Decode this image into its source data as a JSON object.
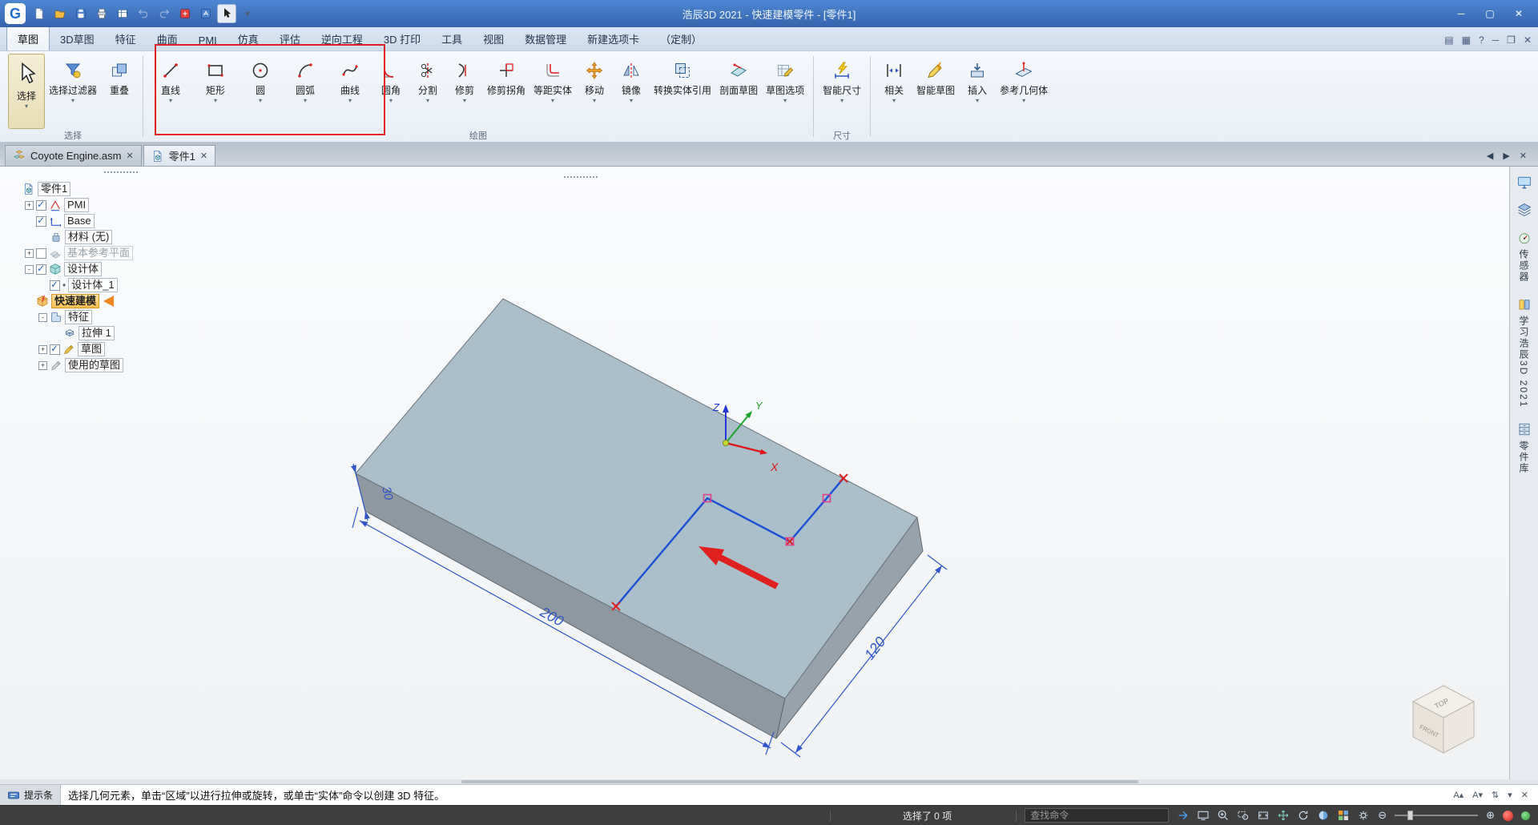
{
  "titlebar": {
    "logo": "G",
    "title": "浩辰3D 2021 - 快速建模零件 - [零件1]",
    "quick_access_icons": [
      {
        "icon": "new-doc-icon"
      },
      {
        "icon": "open-icon"
      },
      {
        "icon": "save-icon"
      },
      {
        "icon": "print-icon"
      },
      {
        "icon": "table-icon"
      },
      {
        "icon": "undo-icon",
        "disabled": true
      },
      {
        "icon": "redo-icon",
        "disabled": true
      },
      {
        "icon": "flag-red-icon"
      },
      {
        "icon": "flag-blue-icon"
      },
      {
        "icon": "select-mode-icon",
        "boxed": true
      },
      {
        "icon": "qat-dropdown-icon"
      }
    ],
    "window_controls": [
      "minimize-icon",
      "maximize-icon",
      "close-icon"
    ]
  },
  "menubar": {
    "tabs": [
      {
        "label": "草图",
        "active": true
      },
      {
        "label": "3D草图"
      },
      {
        "label": "特征"
      },
      {
        "label": "曲面"
      },
      {
        "label": "PMI"
      },
      {
        "label": "仿真"
      },
      {
        "label": "评估"
      },
      {
        "label": "逆向工程"
      },
      {
        "label": "3D 打印"
      },
      {
        "label": "工具"
      },
      {
        "label": "视图"
      },
      {
        "label": "数据管理"
      },
      {
        "label": "新建选项卡"
      },
      {
        "label": "（定制）"
      }
    ],
    "right_icons": [
      "panel1-icon",
      "panel2-icon",
      "help-icon",
      "doc-minimize-icon",
      "doc-restore-icon",
      "doc-close-icon"
    ]
  },
  "ribbon": {
    "groups": [
      {
        "label": "选择",
        "tools": [
          {
            "name": "select",
            "label": "选择",
            "icon": "cursor-icon",
            "big": true,
            "dropdown": true,
            "active": true
          },
          {
            "name": "select-filter",
            "label": "选择过滤器",
            "icon": "filter-icon",
            "dropdown": true
          },
          {
            "name": "overlap",
            "label": "重叠",
            "icon": "overlap-icon",
            "dropdown": false
          }
        ]
      },
      {
        "label": "绘图",
        "tools": [
          {
            "name": "line",
            "label": "直线",
            "icon": "line-icon",
            "dropdown": true,
            "fixed": true
          },
          {
            "name": "rectangle",
            "label": "矩形",
            "icon": "rect-icon",
            "dropdown": true,
            "fixed": true
          },
          {
            "name": "circle",
            "label": "圆",
            "icon": "circle-icon",
            "dropdown": true,
            "fixed": true
          },
          {
            "name": "arc",
            "label": "圆弧",
            "icon": "arc-icon",
            "dropdown": true,
            "fixed": true
          },
          {
            "name": "curve",
            "label": "曲线",
            "icon": "curve-icon",
            "dropdown": true,
            "fixed": true
          },
          {
            "name": "fillet",
            "label": "圆角",
            "icon": "fillet-icon",
            "dropdown": true
          },
          {
            "name": "split",
            "label": "分割",
            "icon": "split-icon",
            "dropdown": true
          },
          {
            "name": "trim",
            "label": "修剪",
            "icon": "trim-icon",
            "dropdown": true
          },
          {
            "name": "trim-corner",
            "label": "修剪拐角",
            "icon": "trim-corner-icon",
            "dropdown": false
          },
          {
            "name": "offset",
            "label": "等距实体",
            "icon": "offset-icon",
            "dropdown": true
          },
          {
            "name": "move",
            "label": "移动",
            "icon": "move-icon",
            "dropdown": true
          },
          {
            "name": "mirror",
            "label": "镜像",
            "icon": "mirror-icon",
            "dropdown": true
          },
          {
            "name": "convert-entities",
            "label": "转换实体引用",
            "icon": "convert-icon",
            "dropdown": false
          },
          {
            "name": "section-sketch",
            "label": "剖面草图",
            "icon": "section-icon",
            "dropdown": false
          },
          {
            "name": "sketch-options",
            "label": "草图选项",
            "icon": "sketch-options-icon",
            "dropdown": true
          }
        ]
      },
      {
        "label": "尺寸",
        "tools": [
          {
            "name": "smart-dimension",
            "label": "智能尺寸",
            "icon": "smart-dim-icon",
            "dropdown": true
          }
        ]
      },
      {
        "label": "",
        "tools": [
          {
            "name": "relate",
            "label": "相关",
            "icon": "relate-icon",
            "dropdown": true
          },
          {
            "name": "smart-sketch",
            "label": "智能草图",
            "icon": "smart-sketch-icon",
            "dropdown": false
          },
          {
            "name": "insert",
            "label": "插入",
            "icon": "insert-icon",
            "dropdown": true
          },
          {
            "name": "ref-geometry",
            "label": "参考几何体",
            "icon": "ref-geometry-icon",
            "dropdown": true
          }
        ]
      }
    ]
  },
  "tabbar": {
    "tabs": [
      {
        "icon": "assembly-icon",
        "label": "Coyote Engine.asm",
        "active": false
      },
      {
        "icon": "part-icon",
        "label": "零件1",
        "active": true
      }
    ],
    "nav_icons": [
      "prev-tab-icon",
      "next-tab-icon",
      "close-tab-icon"
    ]
  },
  "tree": {
    "items": [
      {
        "indent": 0,
        "icon": "part-icon",
        "label": "零件1"
      },
      {
        "indent": 1,
        "expander": "+",
        "checkbox": true,
        "icon": "pmi-icon",
        "label": "PMI"
      },
      {
        "indent": 1,
        "checkbox": true,
        "icon": "base-icon",
        "label": "Base"
      },
      {
        "indent": 2,
        "icon": "material-icon",
        "label": "材料 (无)"
      },
      {
        "indent": 1,
        "expander": "+",
        "checkbox": false,
        "icon": "planes-icon",
        "label": "基本参考平面",
        "grayed": true
      },
      {
        "indent": 1,
        "expander": "-",
        "checkbox": true,
        "icon": "designbody-icon",
        "label": "设计体"
      },
      {
        "indent": 2,
        "checkbox": true,
        "icon": "body-icon",
        "label": "设计体_1"
      },
      {
        "indent": 1,
        "icon": "quickmodel-icon",
        "label": "快速建模",
        "selected": true,
        "arrow": true
      },
      {
        "indent": 2,
        "expander": "-",
        "icon": "features-icon",
        "label": "特征"
      },
      {
        "indent": 3,
        "icon": "extrude-icon",
        "label": "拉伸 1"
      },
      {
        "indent": 2,
        "expander": "+",
        "checkbox": true,
        "icon": "sketch-icon",
        "label": "草图"
      },
      {
        "indent": 2,
        "expander": "+",
        "icon": "usedsketch-icon",
        "label": "使用的草图"
      }
    ]
  },
  "viewport": {
    "dim_length": "200",
    "dim_width": "120",
    "dim_thickness": "30",
    "axis_x": "X",
    "axis_y": "Y",
    "axis_z": "Z",
    "cube_top": "TOP",
    "cube_front": "FRONT"
  },
  "right_rail": {
    "top_icons": [
      "display-icon",
      "layers-icon"
    ],
    "tabs": [
      {
        "icon": "sensor-icon",
        "label": "传感器"
      },
      {
        "icon": "learn-icon",
        "label": "学习浩辰3D 2021"
      },
      {
        "icon": "library-icon",
        "label": "零件库"
      }
    ]
  },
  "prompt_bar": {
    "badge_icon": "tips-icon",
    "badge": "提示条",
    "message": "选择几何元素，单击“区域”以进行拉伸或旋转，或单击“实体”命令以创建 3D 特征。",
    "icons": [
      "font-increase-icon",
      "font-decrease-icon",
      "updown-icon",
      "dropdown-icon",
      "close-icon"
    ]
  },
  "statusbar": {
    "selection": "选择了 0 项",
    "search_placeholder": "查找命令",
    "icons": [
      "go-icon",
      "screen-icon",
      "zoom-in-icon",
      "zoom-window-icon",
      "fit-icon",
      "pan-icon",
      "rotate-icon",
      "shade-icon",
      "styles-icon",
      "gear-icon"
    ],
    "zoom_minus": "⊖",
    "zoom_plus": "⊕"
  }
}
